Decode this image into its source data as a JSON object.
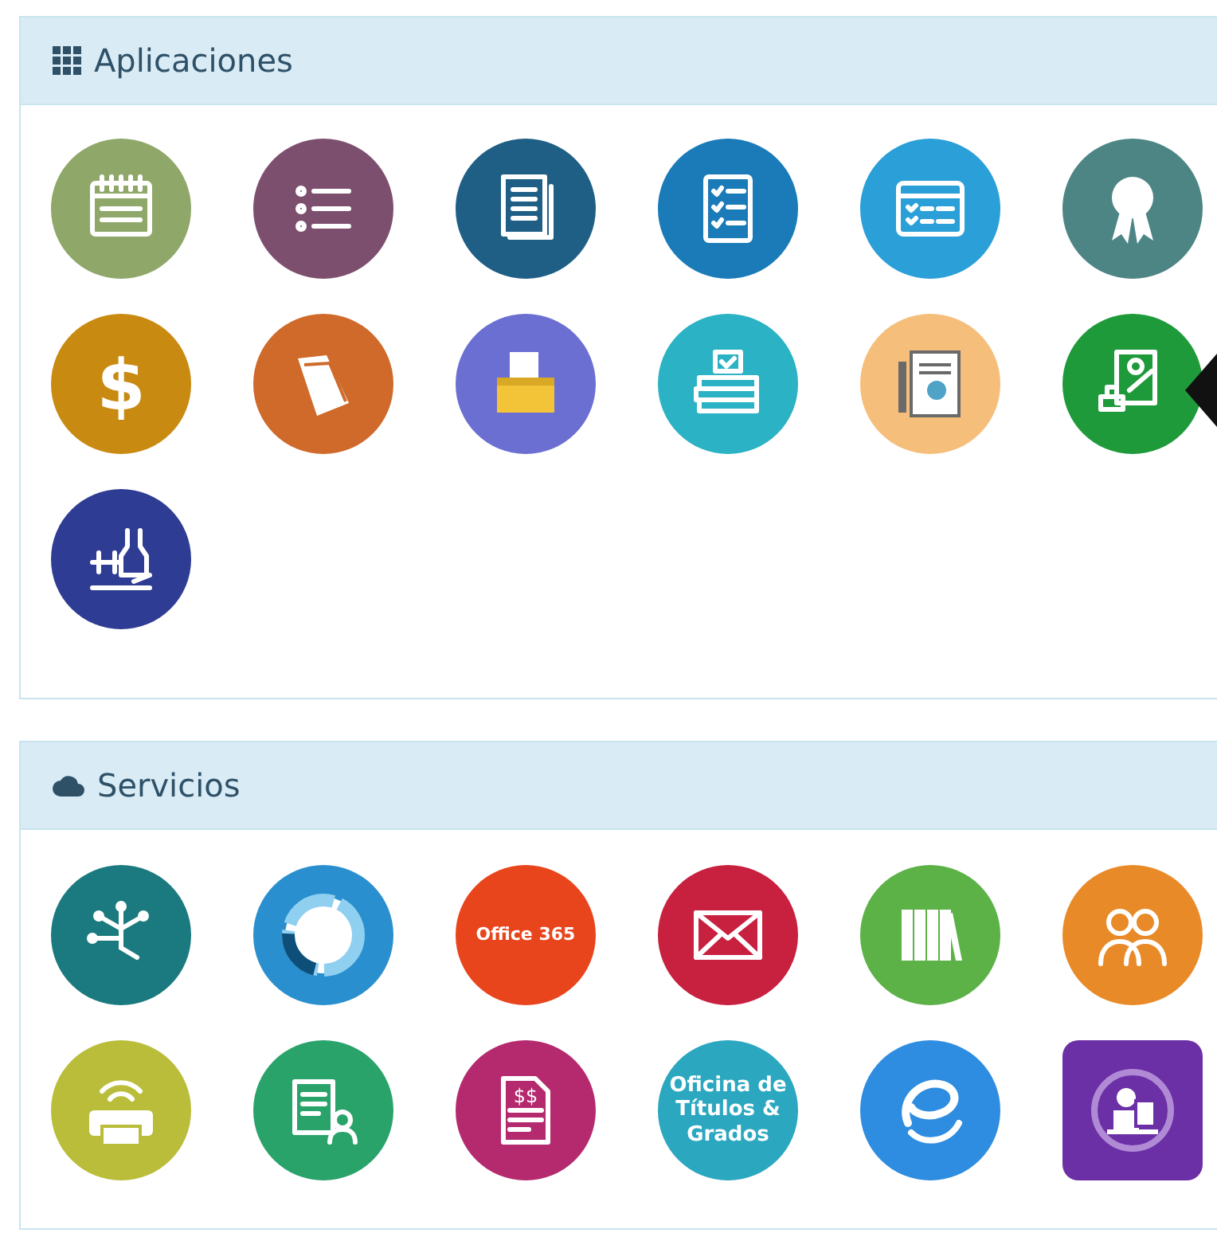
{
  "panels": [
    {
      "title": "Aplicaciones",
      "kind": "grid",
      "tiles": [
        {
          "kind": "calendar",
          "color": "#8fa86a"
        },
        {
          "kind": "list",
          "color": "#7d4f6e"
        },
        {
          "kind": "document",
          "color": "#1f5f86"
        },
        {
          "kind": "checklist",
          "color": "#1a7bb8"
        },
        {
          "kind": "schedule",
          "color": "#2a9fd8"
        },
        {
          "kind": "award",
          "color": "#4d8585"
        },
        {
          "kind": "dollar",
          "color": "#c98a12",
          "symbol": "$"
        },
        {
          "kind": "folder",
          "color": "#cf6a2b"
        },
        {
          "kind": "box",
          "color": "#6b6fd1"
        },
        {
          "kind": "books",
          "color": "#2bb2c4"
        },
        {
          "kind": "certificate",
          "color": "#f5be7a"
        },
        {
          "kind": "stamp",
          "color": "#1e9a3a"
        },
        {
          "kind": "sports",
          "color": "#2f3c93"
        }
      ]
    },
    {
      "title": "Servicios",
      "kind": "cloud",
      "tiles": [
        {
          "kind": "network",
          "color": "#1b7a7f"
        },
        {
          "kind": "cycle",
          "color": "#2a8fce"
        },
        {
          "kind": "office",
          "color": "#e8451c",
          "text": "Office 365"
        },
        {
          "kind": "mail",
          "color": "#c8203f"
        },
        {
          "kind": "library",
          "color": "#5cb247"
        },
        {
          "kind": "people",
          "color": "#e98a28"
        },
        {
          "kind": "printer",
          "color": "#b9bd3a"
        },
        {
          "kind": "writer",
          "color": "#2aa36b"
        },
        {
          "kind": "bill",
          "color": "#b52a6e",
          "symbol": "$$"
        },
        {
          "kind": "label",
          "color": "#2ba7c0",
          "text": "Oficina de Títulos & Grados"
        },
        {
          "kind": "e-logo",
          "color": "#2e8de0"
        },
        {
          "kind": "support",
          "color": "#6b2fa6"
        }
      ]
    }
  ],
  "pointer": {
    "shown": true
  }
}
